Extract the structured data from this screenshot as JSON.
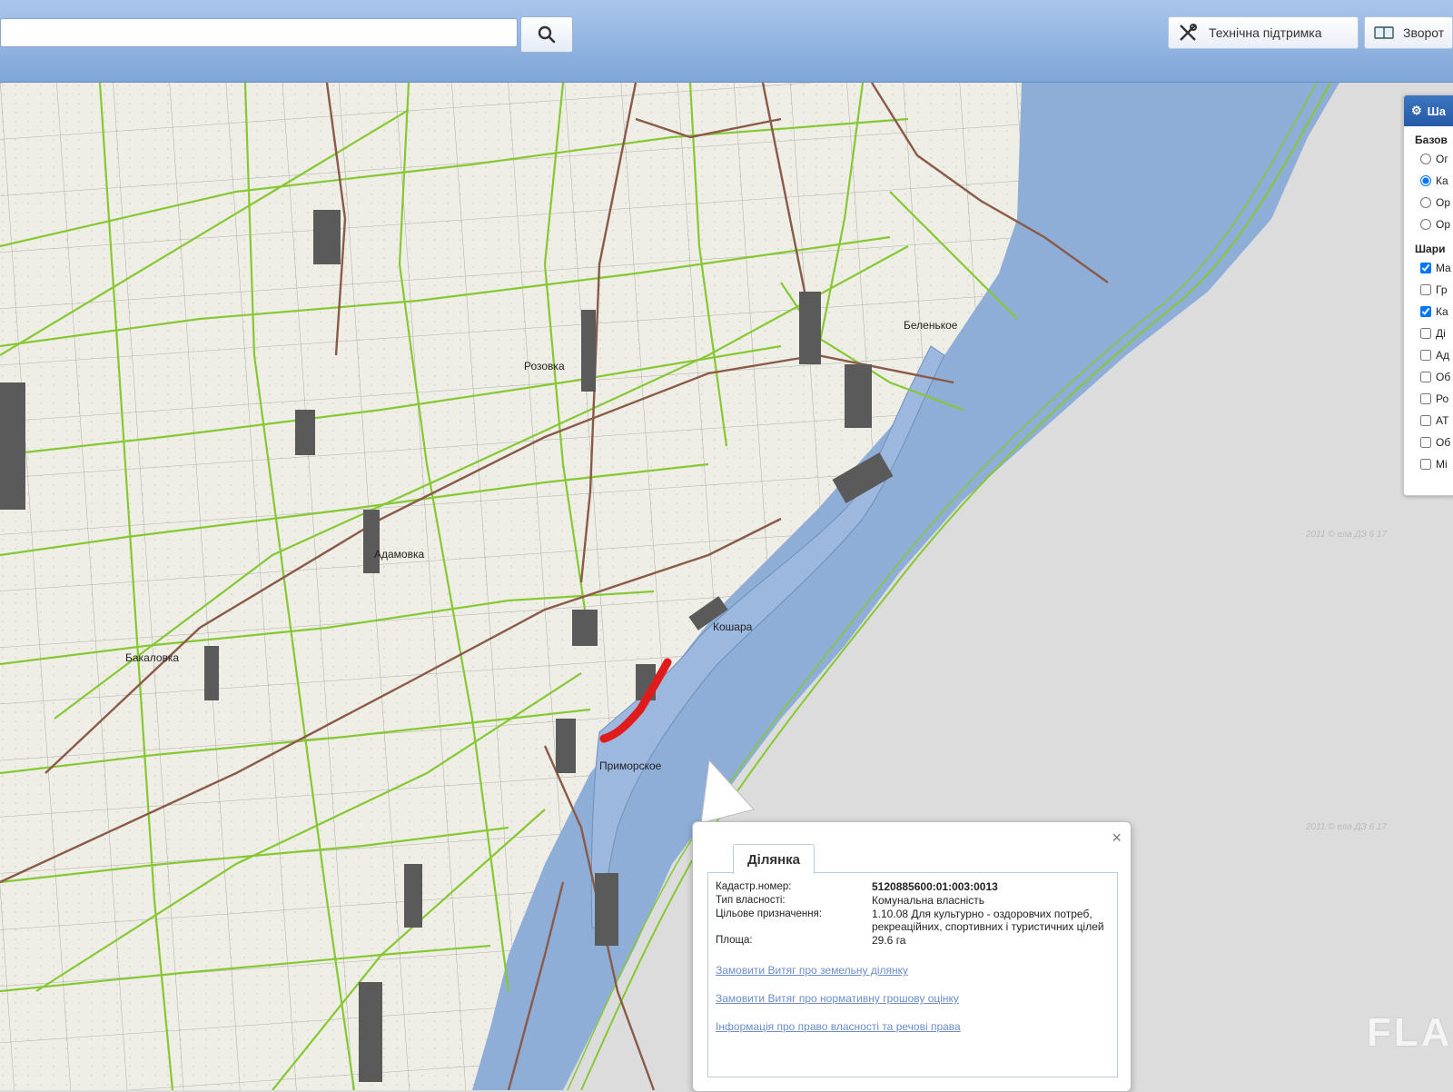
{
  "header": {
    "search": {
      "value": "",
      "placeholder": ""
    },
    "support_label": "Технічна підтримка",
    "feedback_label": "Зворот"
  },
  "layers_panel": {
    "title": "Ша",
    "base_section": "Базов",
    "base_options": [
      {
        "label": "Ог",
        "selected": false
      },
      {
        "label": "Ка",
        "selected": true
      },
      {
        "label": "Ор",
        "selected": false
      },
      {
        "label": "Ор",
        "selected": false
      }
    ],
    "layers_section": "Шари",
    "layers": [
      {
        "label": "Ma",
        "checked": true
      },
      {
        "label": "Гр",
        "checked": false
      },
      {
        "label": "Ка",
        "checked": true
      },
      {
        "label": "Ді",
        "checked": false
      },
      {
        "label": "Ад",
        "checked": false
      },
      {
        "label": "Об",
        "checked": false
      },
      {
        "label": "Ро",
        "checked": false
      },
      {
        "label": "АТ",
        "checked": false
      },
      {
        "label": "Об",
        "checked": false
      },
      {
        "label": "Мі",
        "checked": false
      }
    ]
  },
  "map": {
    "places": [
      "Бакаловка",
      "Адамовка",
      "Розовка",
      "Приморское",
      "Беленькое",
      "Кошара"
    ],
    "highlight_color": "#e01b1b",
    "parcel_line_color": "#86c832",
    "sea_color": "#8eaed8",
    "stamps": [
      "2011 © ела ДЗ 6 17",
      "2011 © ела ДЗ 6 17"
    ],
    "watermark": "FLA"
  },
  "popup": {
    "tab": "Ділянка",
    "fields": [
      {
        "label": "Кадастр.номер:",
        "value": "5120885600:01:003:0013"
      },
      {
        "label": "Тип власності:",
        "value": "Комунальна власність"
      },
      {
        "label": "Цільове призначення:",
        "value": "1.10.08 Для культурно - оздоровчих потреб, рекреаційних, спортивних і туристичних цілей"
      },
      {
        "label": "Площа:",
        "value": "29.6 га"
      }
    ],
    "links": [
      "Замовити Витяг про земельну ділянку",
      "Замовити Витяг про нормативну грошову оцінку",
      "Інформація про право власності та речові права"
    ]
  }
}
